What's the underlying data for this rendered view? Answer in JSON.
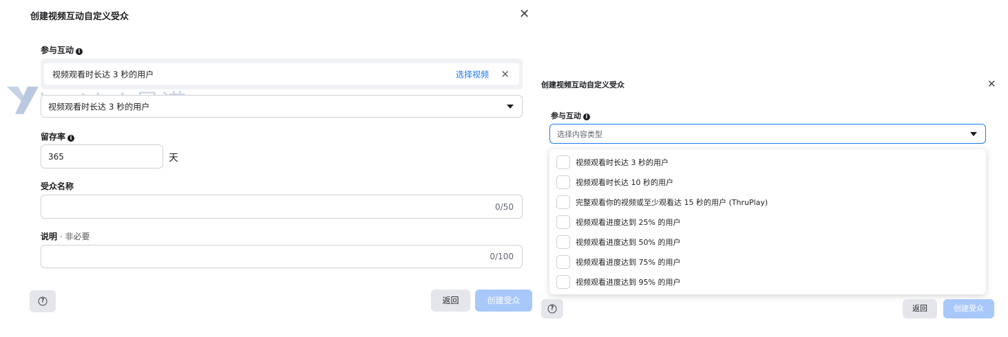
{
  "left": {
    "title": "创建视频互动自定义受众",
    "close": "✕",
    "engagement_label": "参与互动",
    "selected_item": "视频观看时长达 3 秒的用户",
    "choose_video": "选择视频",
    "remove": "✕",
    "dropdown_value": "视频观看时长达 3 秒的用户",
    "retention_label": "留存率",
    "retention_value": "365",
    "retention_unit": "天",
    "audience_name_label": "受众名称",
    "audience_name_counter": "0/50",
    "description_label": "说明",
    "description_optional": " · 非必要",
    "description_counter": "0/100",
    "back": "返回",
    "create": "创建受众"
  },
  "watermark": {
    "text": "inoLink易诺"
  },
  "right": {
    "title": "创建视频互动自定义受众",
    "close": "✕",
    "engagement_label": "参与互动",
    "select_placeholder": "选择内容类型",
    "options": [
      "视频观看时长达 3 秒的用户",
      "视频观看时长达 10 秒的用户",
      "完整观看你的视频或至少观看达 15 秒的用户 (ThruPlay)",
      "视频观看进度达到 25% 的用户",
      "视频观看进度达到 50% 的用户",
      "视频观看进度达到 75% 的用户",
      "视频观看进度达到 95% 的用户"
    ],
    "back": "返回",
    "create": "创建受众"
  },
  "icons": {
    "info": "info-icon",
    "help": "help-icon",
    "caret": "caret-down-icon",
    "close": "close-icon"
  },
  "colors": {
    "link": "#1877f2",
    "create_disabled": "#a8c8fa",
    "focus_border": "#1877f2"
  }
}
